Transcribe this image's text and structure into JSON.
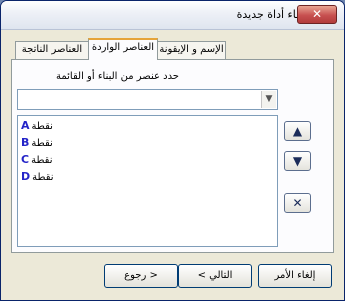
{
  "window": {
    "title": "إنشاء أداة جديدة"
  },
  "title_bar": {
    "close_label": "✕"
  },
  "tabs": [
    {
      "label": "الإسم و الإيقونة",
      "active": false
    },
    {
      "label": "العناصر الواردة",
      "active": true
    },
    {
      "label": "العناصر الناتجة",
      "active": false
    }
  ],
  "panel": {
    "prompt_label": "حدد عنصر من البناء أو القائمة",
    "combo_value": "",
    "items": [
      {
        "letter": "A",
        "text": "نقطة"
      },
      {
        "letter": "B",
        "text": "نقطة"
      },
      {
        "letter": "C",
        "text": "نقطة"
      },
      {
        "letter": "D",
        "text": "نقطة"
      }
    ],
    "move_up_label": "▲",
    "move_down_label": "▼",
    "remove_label": "✕"
  },
  "footer": {
    "cancel_label": "إلغاء الأمر",
    "next_label": "التالي >",
    "back_label": "< رجوع"
  }
}
